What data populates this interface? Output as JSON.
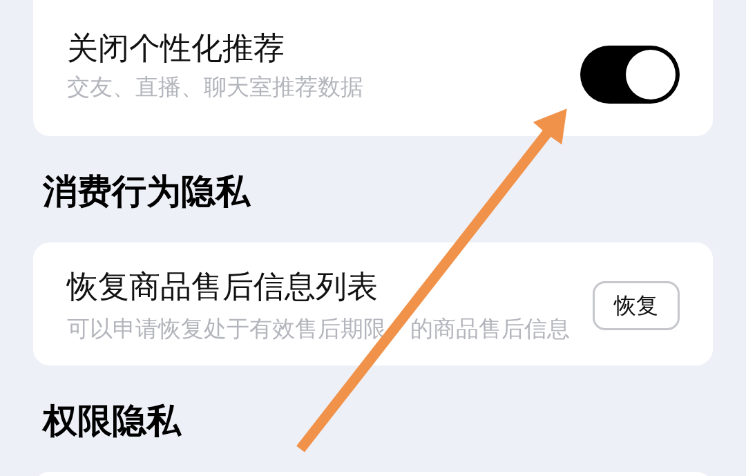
{
  "blocks": [
    {
      "kind": "card",
      "rows": [
        {
          "kind": "toggle",
          "title": "关闭个性化推荐",
          "subtitle": [
            "交友、直播、聊天室推荐数据"
          ],
          "on": true
        }
      ]
    },
    {
      "kind": "heading",
      "text": "消费行为隐私"
    },
    {
      "kind": "card",
      "rows": [
        {
          "kind": "action",
          "title": "恢复商品售后信息列表",
          "subtitle": [
            "可以申请恢复处于有效售后期限",
            "的商品售后信息"
          ],
          "button": "恢复"
        }
      ]
    },
    {
      "kind": "heading",
      "text": "权限隐私"
    },
    {
      "kind": "card"
    }
  ]
}
